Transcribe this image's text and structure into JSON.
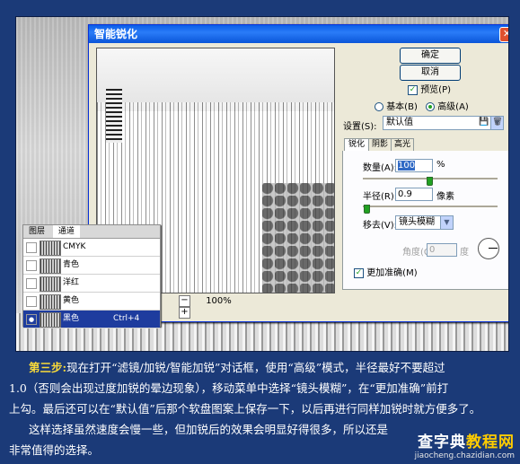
{
  "dialog": {
    "title": "智能锐化",
    "close_glyph": "✕",
    "zoom": {
      "minus": "−",
      "value": "100%",
      "plus": "+"
    },
    "buttons": {
      "ok": "确定",
      "cancel": "取消"
    },
    "preview": {
      "label": "预览(P)",
      "checked": true
    },
    "mode": {
      "basic": "基本(B)",
      "advanced": "高级(A)",
      "selected": "advanced"
    },
    "settings": {
      "label": "设置(S):",
      "value": "默认值"
    },
    "tabs": [
      "锐化",
      "阴影",
      "高光"
    ],
    "sharpen": {
      "amount_label": "数量(A):",
      "amount_value": "100",
      "amount_unit": "%",
      "radius_label": "半径(R):",
      "radius_value": "0.9",
      "radius_unit": "像素",
      "remove_label": "移去(V):",
      "remove_value": "镜头模糊",
      "angle_label": "角度(G):",
      "angle_value": "0",
      "angle_unit": "度",
      "more_accurate_label": "更加准确(M)",
      "more_accurate_checked": true
    }
  },
  "layers_panel": {
    "tabs": [
      "图层",
      "通道"
    ],
    "rows": [
      {
        "name": "CMYK",
        "shortcut": ""
      },
      {
        "name": "青色",
        "shortcut": ""
      },
      {
        "name": "洋红",
        "shortcut": ""
      },
      {
        "name": "黄色",
        "shortcut": ""
      },
      {
        "name": "黑色",
        "shortcut": "Ctrl+4",
        "selected": true
      }
    ]
  },
  "article": {
    "step_label": "第三步:",
    "line1": "现在打开“滤镜/加锐/智能加锐”对话框，使用“高级”模式，半径最好不要超过",
    "line2": "1.0（否则会出现过度加锐的晕边现象），移动菜单中选择“镜头模糊”，在“更加准确”前打",
    "line3": "上勾。最后还可以在“默认值”后那个软盘图案上保存一下，以后再进行同样加锐时就方便多了。",
    "line4": "这样选择虽然速度会慢一些，但加锐后的效果会明显好得很多，所以还是",
    "line5": "非常值得的选择。"
  },
  "watermark": {
    "site_a": "查字典",
    "site_b": "教程网",
    "url": "jiaocheng.chazidian.com"
  },
  "colors": {
    "page_bg": "#1b3a78",
    "step_highlight": "#f7d93a",
    "titlebar": "#0a5de8"
  }
}
